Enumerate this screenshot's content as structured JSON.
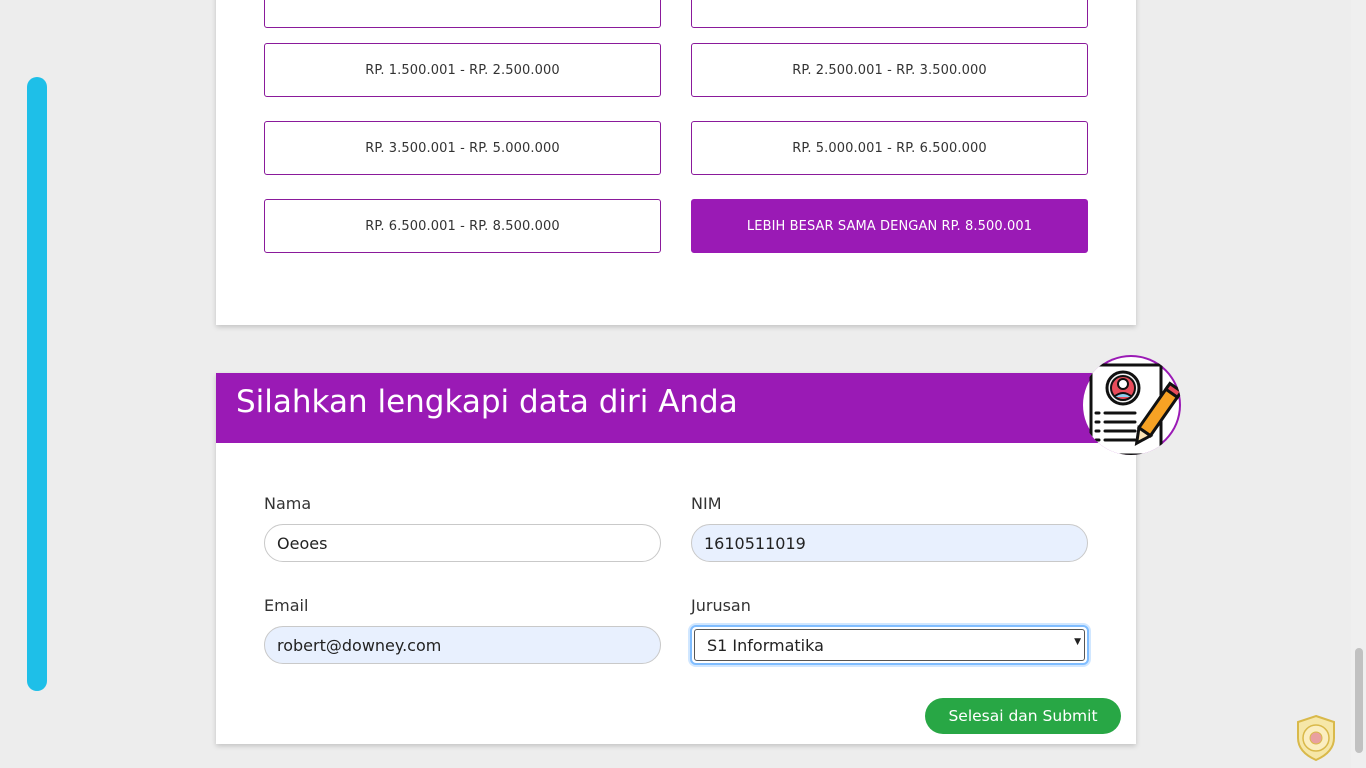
{
  "income_options": [
    {
      "label": "Rp. 1.500.001 - Rp. 2.500.000",
      "selected": false
    },
    {
      "label": "Rp. 2.500.001 - Rp. 3.500.000",
      "selected": false
    },
    {
      "label": "Rp. 3.500.001 - Rp. 5.000.000",
      "selected": false
    },
    {
      "label": "Rp. 5.000.001 - Rp. 6.500.000",
      "selected": false
    },
    {
      "label": "Rp. 6.500.001 - Rp. 8.500.000",
      "selected": false
    },
    {
      "label": "Lebih besar sama dengan Rp. 8.500.001",
      "selected": true
    }
  ],
  "form": {
    "title": "Silahkan lengkapi data diri Anda",
    "nama": {
      "label": "Nama",
      "value": "Oeoes"
    },
    "nim": {
      "label": "NIM",
      "value": "1610511019"
    },
    "email": {
      "label": "Email",
      "value": "robert@downey.com"
    },
    "jurusan": {
      "label": "Jurusan",
      "value": "S1 Informatika"
    },
    "submit_label": "Selesai dan Submit"
  },
  "icons": {
    "badge": "profile-form-pencil-icon",
    "seal": "university-seal-logo",
    "select_caret": "chevron-down-icon"
  },
  "colors": {
    "primary": "#9a1ab5",
    "accent_bar": "#1ebfe8",
    "submit": "#28a745",
    "autofill": "#e8f0fe"
  }
}
